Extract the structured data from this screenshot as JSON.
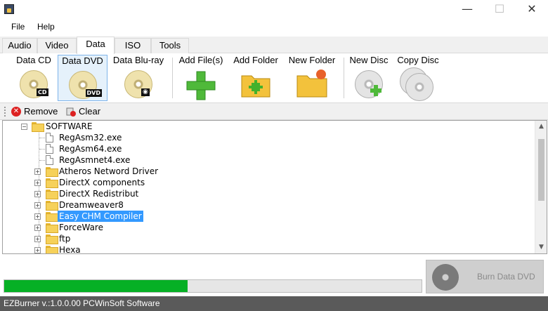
{
  "menu": {
    "file": "File",
    "help": "Help"
  },
  "tabs": [
    "Audio",
    "Video",
    "Data",
    "ISO",
    "Tools"
  ],
  "toolbar": {
    "data_cd": "Data CD",
    "data_dvd": "Data DVD",
    "data_bluray": "Data Blu-ray",
    "add_files": "Add File(s)",
    "add_folder": "Add Folder",
    "new_folder": "New Folder",
    "new_disc": "New Disc",
    "copy_disc": "Copy Disc",
    "cd_tag": "CD",
    "dvd_tag": "DVD"
  },
  "subbar": {
    "remove": "Remove",
    "clear": "Clear"
  },
  "tree": {
    "root": "SOFTWARE",
    "files": [
      "RegAsm32.exe",
      "RegAsm64.exe",
      "RegAsmnet4.exe"
    ],
    "folders": [
      "Atheros Netword Driver",
      "DirectX components",
      "DirectX Redistribut",
      "Dreamweaver8",
      "Easy CHM Compiler",
      "ForceWare",
      "ftp",
      "Hexa"
    ],
    "selected": "Easy CHM Compiler"
  },
  "progress": {
    "fraction": 0.44
  },
  "burn_button": "Burn Data DVD",
  "status": "EZBurner v.:1.0.0.00 PCWinSoft Software",
  "colors": {
    "progress": "#06b025",
    "selection": "#3399ff",
    "statusbar": "#5a5a5a"
  }
}
